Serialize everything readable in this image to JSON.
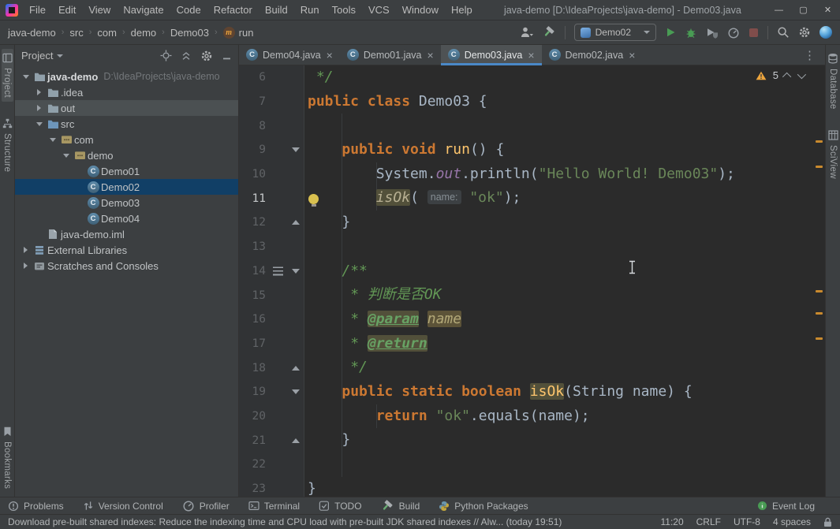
{
  "window": {
    "title": "java-demo [D:\\IdeaProjects\\java-demo] - Demo03.java",
    "controls": {
      "minimize": "—",
      "maximize": "▢",
      "close": "✕"
    }
  },
  "menu": [
    "File",
    "Edit",
    "View",
    "Navigate",
    "Code",
    "Refactor",
    "Build",
    "Run",
    "Tools",
    "VCS",
    "Window",
    "Help"
  ],
  "breadcrumbs": [
    {
      "label": "java-demo"
    },
    {
      "label": "src"
    },
    {
      "label": "com"
    },
    {
      "label": "demo"
    },
    {
      "label": "Demo03"
    },
    {
      "label": "run",
      "icon": "method-icon"
    }
  ],
  "toolbar": {
    "left_icons": [
      "user-icon",
      "hammer-icon"
    ],
    "run_config": {
      "icon": "app-icon",
      "label": "Demo02"
    },
    "run_actions": [
      "run-icon",
      "debug-icon",
      "coverage-icon",
      "profiler-icon",
      "stop-icon"
    ],
    "right_icons": [
      "search-icon",
      "settings-gear-icon",
      "code-with-me-icon"
    ]
  },
  "stripes": {
    "left": [
      {
        "label": "Project",
        "icon": "project-icon",
        "active": true
      },
      {
        "label": "Structure",
        "icon": "structure-icon",
        "active": false
      }
    ],
    "left_bottom": [
      {
        "label": "Bookmarks",
        "icon": "bookmarks-icon",
        "active": false
      }
    ],
    "right": [
      {
        "label": "Database",
        "icon": "database-icon",
        "active": false
      },
      {
        "label": "SciView",
        "icon": "sciview-icon",
        "active": false
      }
    ]
  },
  "project_tree": {
    "header": "Project",
    "header_icons": [
      "locate-icon",
      "collapse-all-icon",
      "settings-gear-icon",
      "hide-icon"
    ],
    "items": [
      {
        "label": "java-demo",
        "hint": "D:\\IdeaProjects\\java-demo",
        "indent": 0,
        "chevron": "down",
        "icon": "folder-icon",
        "bold": true
      },
      {
        "label": ".idea",
        "indent": 1,
        "chevron": "right",
        "icon": "folder-icon"
      },
      {
        "label": "out",
        "indent": 1,
        "chevron": "right",
        "icon": "folder-icon",
        "state": "hover"
      },
      {
        "label": "src",
        "indent": 1,
        "chevron": "down",
        "icon": "folder-src-icon"
      },
      {
        "label": "com",
        "indent": 2,
        "chevron": "down",
        "icon": "package-icon"
      },
      {
        "label": "demo",
        "indent": 3,
        "chevron": "down",
        "icon": "package-icon"
      },
      {
        "label": "Demo01",
        "indent": 4,
        "icon": "class-icon"
      },
      {
        "label": "Demo02",
        "indent": 4,
        "icon": "class-icon",
        "state": "selected"
      },
      {
        "label": "Demo03",
        "indent": 4,
        "icon": "class-icon"
      },
      {
        "label": "Demo04",
        "indent": 4,
        "icon": "class-icon"
      },
      {
        "label": "java-demo.iml",
        "indent": 1,
        "icon": "file-icon"
      },
      {
        "label": "External Libraries",
        "indent": 0,
        "chevron": "right",
        "icon": "library-icon"
      },
      {
        "label": "Scratches and Consoles",
        "indent": 0,
        "chevron": "right",
        "icon": "scratch-icon"
      }
    ]
  },
  "tabs": [
    {
      "label": "Demo04.java",
      "icon": "class-icon",
      "active": false
    },
    {
      "label": "Demo01.java",
      "icon": "class-icon",
      "active": false
    },
    {
      "label": "Demo03.java",
      "icon": "class-icon",
      "active": true
    },
    {
      "label": "Demo02.java",
      "icon": "class-icon",
      "active": false
    }
  ],
  "editor": {
    "inspection": {
      "warnings": "5"
    },
    "lines": [
      {
        "n": 6,
        "segs": [
          {
            "t": " */",
            "c": "cmt"
          }
        ]
      },
      {
        "n": 7,
        "segs": [
          {
            "t": "public class",
            "c": "kw"
          },
          {
            "t": " Demo03 {",
            "c": "pl"
          }
        ]
      },
      {
        "n": 8,
        "segs": []
      },
      {
        "n": 9,
        "fold": "down",
        "segs": [
          {
            "t": "    ",
            "c": "pl"
          },
          {
            "t": "public void",
            "c": "kw"
          },
          {
            "t": " ",
            "c": "pl"
          },
          {
            "t": "run",
            "c": "decl"
          },
          {
            "t": "() {",
            "c": "pl"
          }
        ]
      },
      {
        "n": 10,
        "segs": [
          {
            "t": "        System.",
            "c": "pl"
          },
          {
            "t": "out",
            "c": "field"
          },
          {
            "t": ".println(",
            "c": "pl"
          },
          {
            "t": "\"Hello World! Demo03\"",
            "c": "str"
          },
          {
            "t": ");",
            "c": "pl"
          }
        ]
      },
      {
        "n": 11,
        "cur": true,
        "bulb": true,
        "segs": [
          {
            "t": "        ",
            "c": "pl"
          },
          {
            "t": "isOk",
            "c": "scall hl"
          },
          {
            "t": "( ",
            "c": "pl"
          },
          {
            "t": "name:",
            "c": "hint"
          },
          {
            "t": " ",
            "c": "pl"
          },
          {
            "t": "\"ok\"",
            "c": "str"
          },
          {
            "t": ");",
            "c": "pl"
          }
        ]
      },
      {
        "n": 12,
        "fold": "up",
        "segs": [
          {
            "t": "    }",
            "c": "pl"
          }
        ]
      },
      {
        "n": 13,
        "segs": []
      },
      {
        "n": 14,
        "fold": "down",
        "gicon": true,
        "segs": [
          {
            "t": "    ",
            "c": "pl"
          },
          {
            "t": "/**",
            "c": "cmt"
          }
        ]
      },
      {
        "n": 15,
        "segs": [
          {
            "t": "     ",
            "c": "pl"
          },
          {
            "t": "* 判断是否OK",
            "c": "cmt"
          }
        ]
      },
      {
        "n": 16,
        "segs": [
          {
            "t": "     ",
            "c": "pl"
          },
          {
            "t": "* ",
            "c": "cmt"
          },
          {
            "t": "@param",
            "c": "tag hl"
          },
          {
            "t": " ",
            "c": "cmt"
          },
          {
            "t": "name",
            "c": "pname hl2"
          }
        ]
      },
      {
        "n": 17,
        "segs": [
          {
            "t": "     ",
            "c": "pl"
          },
          {
            "t": "* ",
            "c": "cmt"
          },
          {
            "t": "@return",
            "c": "tag hl"
          }
        ]
      },
      {
        "n": 18,
        "fold": "up",
        "segs": [
          {
            "t": "     ",
            "c": "pl"
          },
          {
            "t": "*/",
            "c": "cmt"
          }
        ]
      },
      {
        "n": 19,
        "fold": "down",
        "segs": [
          {
            "t": "    ",
            "c": "pl"
          },
          {
            "t": "public static boolean",
            "c": "kw"
          },
          {
            "t": " ",
            "c": "pl"
          },
          {
            "t": "isOk",
            "c": "decl hl"
          },
          {
            "t": "(String name) {",
            "c": "pl"
          }
        ]
      },
      {
        "n": 20,
        "segs": [
          {
            "t": "        ",
            "c": "pl"
          },
          {
            "t": "return ",
            "c": "kw"
          },
          {
            "t": "\"ok\"",
            "c": "str"
          },
          {
            "t": ".equals(name);",
            "c": "pl"
          }
        ]
      },
      {
        "n": 21,
        "fold": "up",
        "segs": [
          {
            "t": "    }",
            "c": "pl"
          }
        ]
      },
      {
        "n": 22,
        "segs": []
      },
      {
        "n": 23,
        "segs": [
          {
            "t": "}",
            "c": "pl"
          }
        ]
      }
    ],
    "scroll_marks_y": [
      95,
      127,
      285,
      313,
      345
    ]
  },
  "bottom_bar": {
    "left": [
      {
        "label": "Problems",
        "icon": "problems-icon"
      },
      {
        "label": "Version Control",
        "icon": "version-control-icon"
      },
      {
        "label": "Profiler",
        "icon": "profiler-icon"
      },
      {
        "label": "Terminal",
        "icon": "terminal-icon"
      },
      {
        "label": "TODO",
        "icon": "todo-icon"
      },
      {
        "label": "Build",
        "icon": "hammer-icon"
      },
      {
        "label": "Python Packages",
        "icon": "python-icon"
      }
    ],
    "right": [
      {
        "label": "Event Log",
        "icon": "event-log-icon"
      }
    ]
  },
  "status_bar": {
    "message": "Download pre-built shared indexes: Reduce the indexing time and CPU load with pre-built JDK shared indexes // Alw... (today 19:51)",
    "items": [
      "11:20",
      "CRLF",
      "UTF-8",
      "4 spaces"
    ],
    "icons": [
      "lock-icon"
    ]
  },
  "colors": {
    "accent_blue": "#4a88c7",
    "selection_blue": "#113f66",
    "hover_gray": "#4b5052",
    "run_green": "#499c54",
    "warning_orange": "#eda53c",
    "highlight_tan": "#52503a",
    "editor_bg": "#2b2b2b",
    "panel_bg": "#3c3f41"
  }
}
